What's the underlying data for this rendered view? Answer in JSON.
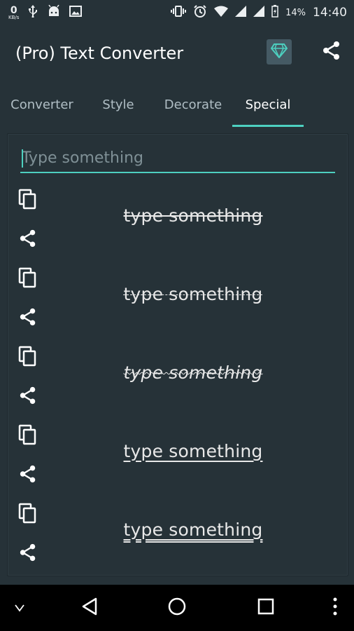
{
  "status_bar": {
    "net_speed": "0",
    "net_unit": "KB/s",
    "battery_pct": "14%",
    "time": "14:40",
    "icons": [
      "usb-icon",
      "android-icon",
      "image-icon",
      "vibrate-icon",
      "alarm-icon",
      "wifi-icon",
      "signal-icon",
      "signal-icon",
      "battery-charging-icon"
    ]
  },
  "app_bar": {
    "title": "(Pro) Text Converter",
    "gem_icon": "gem-icon",
    "share_icon": "share-icon",
    "accent": "#4dd0c0"
  },
  "tabs": [
    {
      "label": "Converter"
    },
    {
      "label": "Style"
    },
    {
      "label": "Decorate"
    },
    {
      "label": "Special",
      "active": true
    }
  ],
  "input": {
    "placeholder": "Type something",
    "value": ""
  },
  "outputs": [
    {
      "text": "type something",
      "style": "strikethrough"
    },
    {
      "text": "type something",
      "style": "short-strikethrough"
    },
    {
      "text": "type something",
      "style": "slash-overlay"
    },
    {
      "text": "type something",
      "style": "underline"
    },
    {
      "text": "type something",
      "style": "double-underline"
    }
  ],
  "nav_bar": {
    "items": [
      "chevron-down-icon",
      "back-icon",
      "home-icon",
      "recents-icon",
      "more-vert-icon"
    ]
  }
}
